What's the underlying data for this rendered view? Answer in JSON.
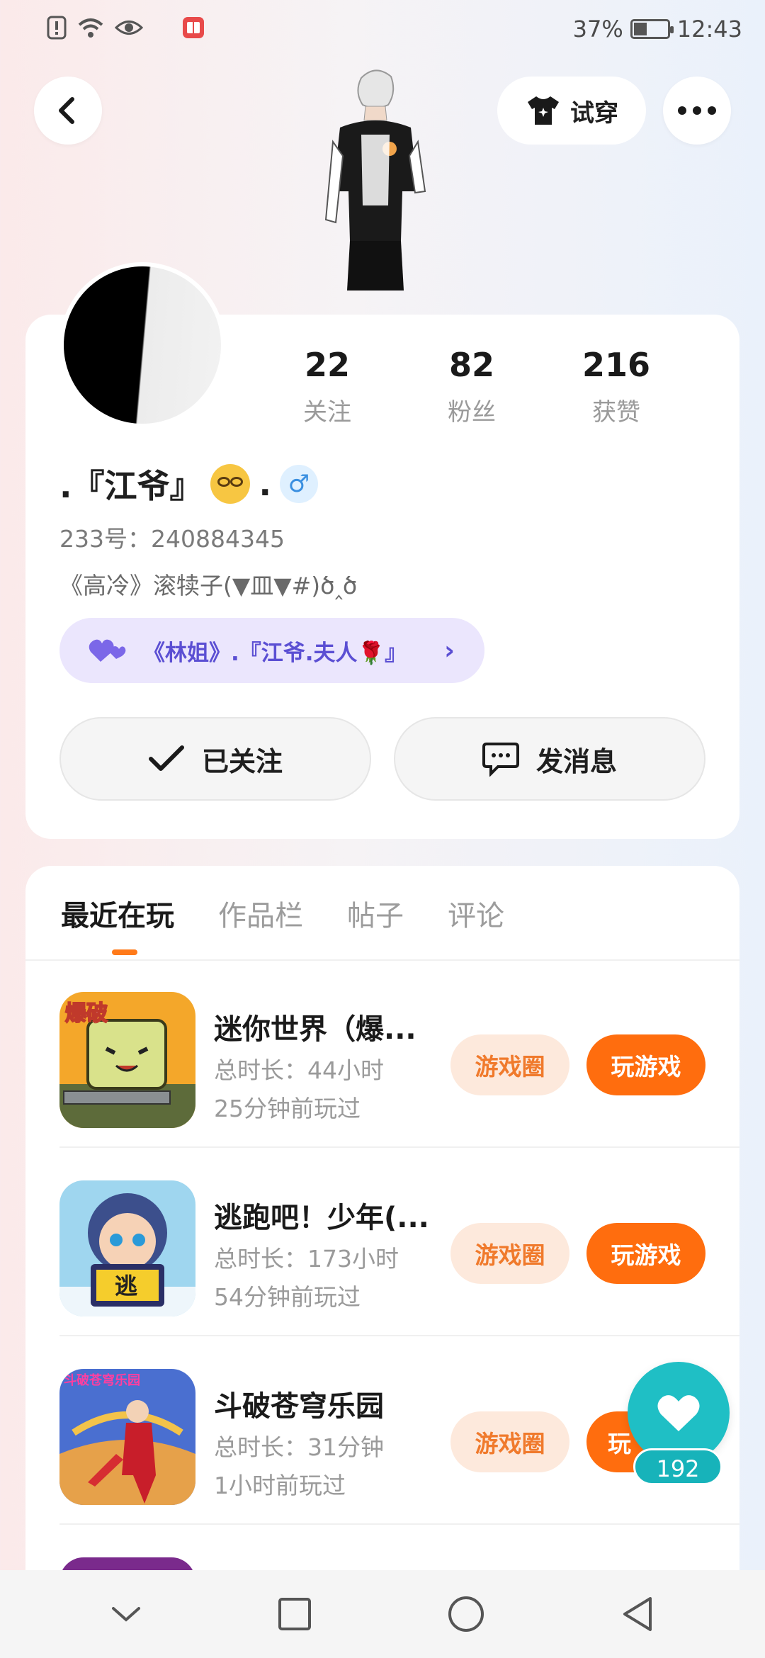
{
  "status_bar": {
    "battery": "37%",
    "time": "12:43",
    "battery_level": 0.37
  },
  "header": {
    "try_on_label": "试穿"
  },
  "profile": {
    "stats": [
      {
        "value": "22",
        "label": "关注"
      },
      {
        "value": "82",
        "label": "粉丝"
      },
      {
        "value": "216",
        "label": "获赞"
      }
    ],
    "nickname_prefix": ".『江爷』",
    "nickname_suffix": ".",
    "gender_symbol": "♂",
    "uid": "233号：240884345",
    "bio": "《高冷》滚犊子(▼皿▼#)ծ‸ծ",
    "couple_tag": "《林姐》.『江爷.夫人🌹』",
    "follow_label": "已关注",
    "message_label": "发消息"
  },
  "tabs": [
    "最近在玩",
    "作品栏",
    "帖子",
    "评论"
  ],
  "games": [
    {
      "title": "迷你世界（爆...",
      "duration": "总时长：44小时",
      "last_played": "25分钟前玩过",
      "circle_label": "游戏圈",
      "play_label": "玩游戏"
    },
    {
      "title": "逃跑吧！少年(...",
      "duration": "总时长：173小时",
      "last_played": "54分钟前玩过",
      "circle_label": "游戏圈",
      "play_label": "玩游戏"
    },
    {
      "title": "斗破苍穹乐园",
      "duration": "总时长：31分钟",
      "last_played": "1小时前玩过",
      "circle_label": "游戏圈",
      "play_label": "玩"
    }
  ],
  "icon_text": {
    "game1_badge": "爆破",
    "game2_badge": "逃",
    "game3_badge": "斗破苍穹乐园"
  },
  "fab": {
    "count": "192"
  },
  "colors": {
    "accent": "#ff6d0e",
    "fab": "#1fbfc5",
    "couple_tag": "#5b4fd3"
  }
}
